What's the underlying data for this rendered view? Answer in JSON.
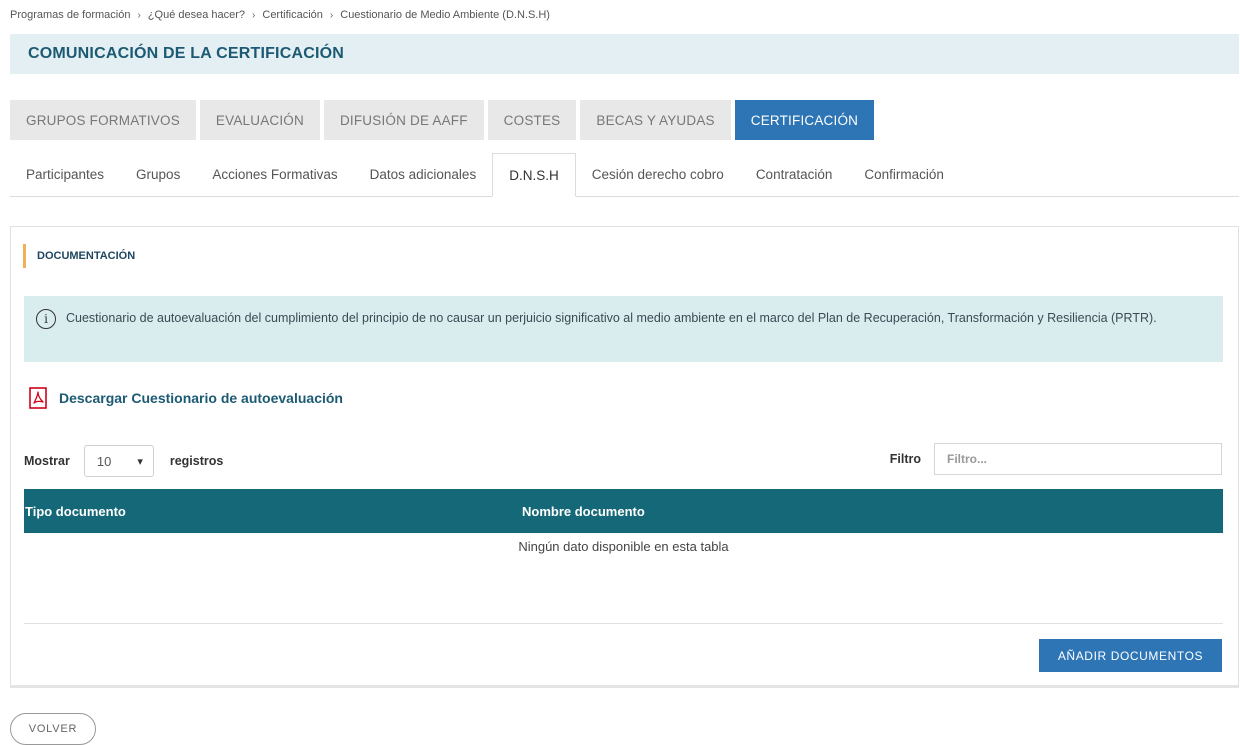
{
  "breadcrumb": {
    "items": [
      "Programas de formación",
      "¿Qué desea hacer?",
      "Certificación",
      "Cuestionario de Medio Ambiente (D.N.S.H)"
    ]
  },
  "page": {
    "title": "COMUNICACIÓN DE LA CERTIFICACIÓN"
  },
  "main_tabs": [
    {
      "label": "GRUPOS FORMATIVOS",
      "active": false
    },
    {
      "label": "EVALUACIÓN",
      "active": false
    },
    {
      "label": "DIFUSIÓN DE AAFF",
      "active": false
    },
    {
      "label": "COSTES",
      "active": false
    },
    {
      "label": "BECAS Y AYUDAS",
      "active": false
    },
    {
      "label": "CERTIFICACIÓN",
      "active": true
    }
  ],
  "sub_tabs": [
    {
      "label": "Participantes",
      "active": false
    },
    {
      "label": "Grupos",
      "active": false
    },
    {
      "label": "Acciones Formativas",
      "active": false
    },
    {
      "label": "Datos adicionales",
      "active": false
    },
    {
      "label": "D.N.S.H",
      "active": true
    },
    {
      "label": "Cesión derecho cobro",
      "active": false
    },
    {
      "label": "Contratación",
      "active": false
    },
    {
      "label": "Confirmación",
      "active": false
    }
  ],
  "section": {
    "title": "DOCUMENTACIÓN"
  },
  "info": {
    "icon": "info-icon",
    "text": "Cuestionario de autoevaluación del cumplimiento del principio de no causar un perjuicio significativo al medio ambiente en el marco del Plan de Recuperación, Transformación y Resiliencia (PRTR)."
  },
  "download": {
    "label": "Descargar Cuestionario de autoevaluación",
    "icon": "pdf-icon",
    "icon_color": "#d0021b"
  },
  "table_controls": {
    "show_label": "Mostrar",
    "page_size": "10",
    "records_label": "registros",
    "filter_label": "Filtro",
    "filter_placeholder": "Filtro..."
  },
  "table": {
    "columns": [
      "Tipo documento",
      "Nombre documento"
    ],
    "empty_message": "Ningún dato disponible en esta tabla",
    "header_color": "#146877"
  },
  "actions": {
    "add_documents": "AÑADIR DOCUMENTOS",
    "back": "VOLVER"
  },
  "colors": {
    "primary": "#2e75b6",
    "title": "#1c5a73",
    "accent_bar": "#f0b15a",
    "info_bg": "#d9ecee"
  }
}
